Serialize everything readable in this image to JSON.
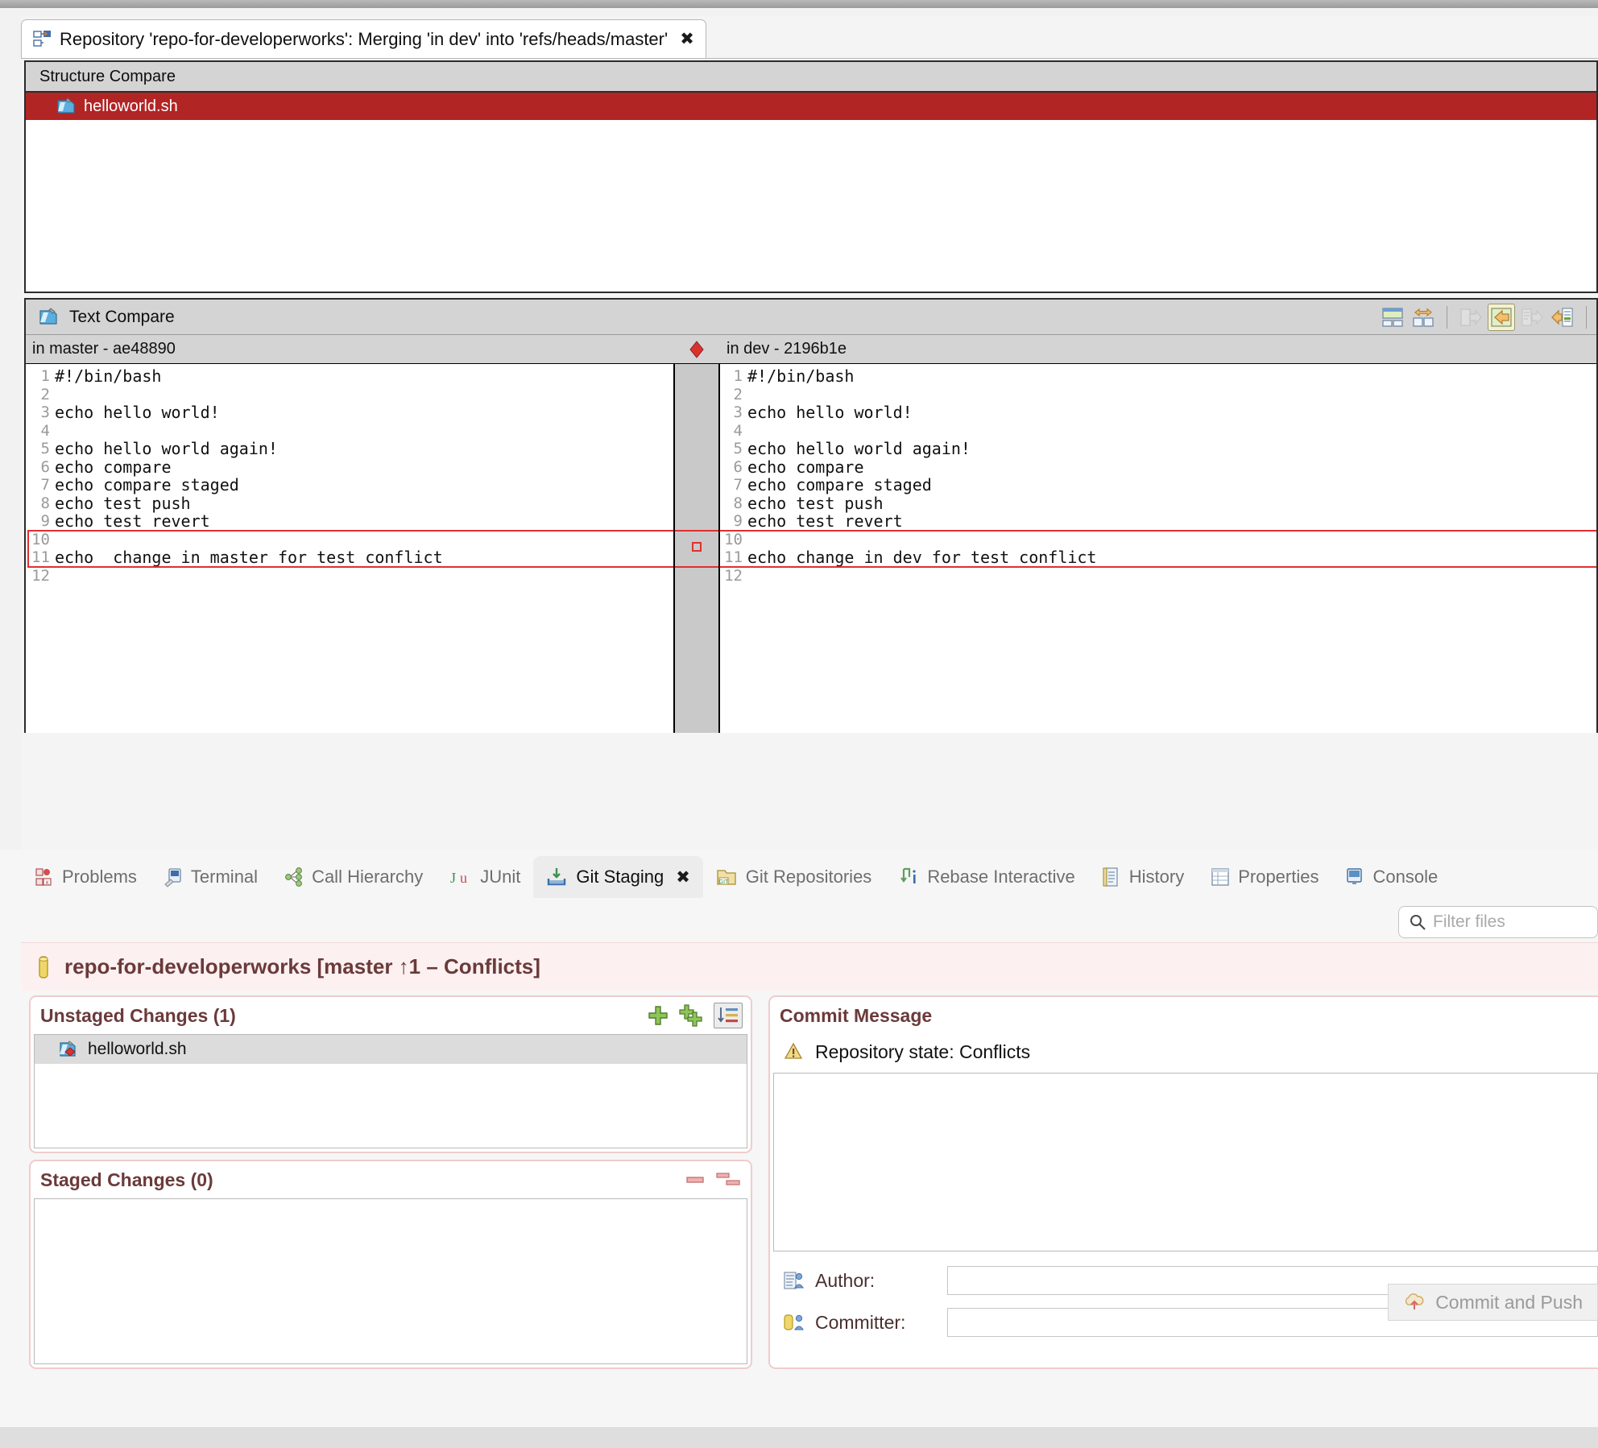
{
  "editor": {
    "tab_title": "Repository 'repo-for-developerworks': Merging 'in dev' into 'refs/heads/master'",
    "tab_close": "✖",
    "structure_compare": {
      "title": "Structure Compare",
      "rows": [
        {
          "name": "helloworld.sh"
        }
      ]
    },
    "text_compare": {
      "title": "Text Compare",
      "toolbar": [
        {
          "name": "two-pane-layout-icon",
          "tip": "Two-Pane Layout"
        },
        {
          "name": "switch-left-right-icon",
          "tip": "Switch Left and Right View"
        },
        {
          "name": "copy-all-right-icon",
          "tip": "Copy All from Left to Right"
        },
        {
          "name": "copy-all-left-icon",
          "tip": "Copy All from Right to Left"
        },
        {
          "name": "copy-current-right-icon",
          "tip": "Copy Current Change from Left to Right"
        },
        {
          "name": "copy-current-left-icon",
          "tip": "Copy Current Change from Right to Left"
        }
      ],
      "left": {
        "header": "in master - ae48890",
        "lines": [
          {
            "n": "1",
            "text": "#!/bin/bash"
          },
          {
            "n": "2",
            "text": ""
          },
          {
            "n": "3",
            "text": "echo hello world!"
          },
          {
            "n": "4",
            "text": ""
          },
          {
            "n": "5",
            "text": "echo hello world again!"
          },
          {
            "n": "6",
            "text": "echo compare"
          },
          {
            "n": "7",
            "text": "echo compare staged"
          },
          {
            "n": "8",
            "text": "echo test push"
          },
          {
            "n": "9",
            "text": "echo test revert"
          },
          {
            "n": "10",
            "text": ""
          },
          {
            "n": "11",
            "text": "echo  change in master for test conflict"
          },
          {
            "n": "12",
            "text": ""
          }
        ],
        "conflict_lines": [
          "10",
          "11"
        ]
      },
      "right": {
        "header": "in dev - 2196b1e",
        "lines": [
          {
            "n": "1",
            "text": "#!/bin/bash"
          },
          {
            "n": "2",
            "text": ""
          },
          {
            "n": "3",
            "text": "echo hello world!"
          },
          {
            "n": "4",
            "text": ""
          },
          {
            "n": "5",
            "text": "echo hello world again!"
          },
          {
            "n": "6",
            "text": "echo compare"
          },
          {
            "n": "7",
            "text": "echo compare staged"
          },
          {
            "n": "8",
            "text": "echo test push"
          },
          {
            "n": "9",
            "text": "echo test revert"
          },
          {
            "n": "10",
            "text": ""
          },
          {
            "n": "11",
            "text": "echo change in dev for test conflict"
          },
          {
            "n": "12",
            "text": ""
          }
        ],
        "conflict_lines": [
          "10",
          "11"
        ]
      },
      "conflict_marker_icon": "red-diamond-icon"
    }
  },
  "bottom_views": {
    "tabs": [
      {
        "label": "Problems",
        "icon": "problems-icon",
        "selected": false
      },
      {
        "label": "Terminal",
        "icon": "terminal-icon",
        "selected": false
      },
      {
        "label": "Call Hierarchy",
        "icon": "call-hierarchy-icon",
        "selected": false
      },
      {
        "label": "JUnit",
        "icon": "junit-icon",
        "selected": false
      },
      {
        "label": "Git Staging",
        "icon": "git-staging-icon",
        "selected": true
      },
      {
        "label": "Git Repositories",
        "icon": "git-repositories-icon",
        "selected": false
      },
      {
        "label": "Rebase Interactive",
        "icon": "rebase-interactive-icon",
        "selected": false
      },
      {
        "label": "History",
        "icon": "history-icon",
        "selected": false
      },
      {
        "label": "Properties",
        "icon": "properties-icon",
        "selected": false
      },
      {
        "label": "Console",
        "icon": "console-icon",
        "selected": false
      }
    ],
    "selected_tab_close": "✖"
  },
  "git_staging": {
    "filter": {
      "placeholder": "Filter files",
      "value": "",
      "icon": "search-icon"
    },
    "repository_title": "repo-for-developerworks [master ↑1 – Conflicts]",
    "repository_icon": "repository-icon",
    "unstaged": {
      "title": "Unstaged Changes (1)",
      "tools": [
        {
          "name": "stage-selected-button",
          "icon": "plus-icon"
        },
        {
          "name": "stage-all-button",
          "icon": "plus-all-icon"
        },
        {
          "name": "toggle-sort-button",
          "icon": "sort-list-icon"
        }
      ],
      "files": [
        {
          "name": "helloworld.sh",
          "icon": "conflict-file-icon"
        }
      ]
    },
    "staged": {
      "title": "Staged Changes (0)",
      "tools": [
        {
          "name": "unstage-selected-button",
          "icon": "minus-icon"
        },
        {
          "name": "unstage-all-button",
          "icon": "minus-all-icon"
        }
      ],
      "files": []
    },
    "commit_message": {
      "title": "Commit Message",
      "state_icon": "warning-icon",
      "state_text": "Repository state: Conflicts",
      "message_value": "",
      "author_label": "Author:",
      "author_icon": "author-icon",
      "author_value": "",
      "committer_label": "Committer:",
      "committer_icon": "committer-icon",
      "committer_value": "",
      "commit_and_push_label": "Commit and Push",
      "commit_and_push_icon": "push-icon"
    }
  },
  "colors": {
    "conflict_red": "#e03030",
    "conflict_fill": "#f2c9c9",
    "structure_selection": "#b22525",
    "banner_bg": "#fdf0f0",
    "section_border": "#f0cccc",
    "heading_text": "#6b3a3a"
  }
}
